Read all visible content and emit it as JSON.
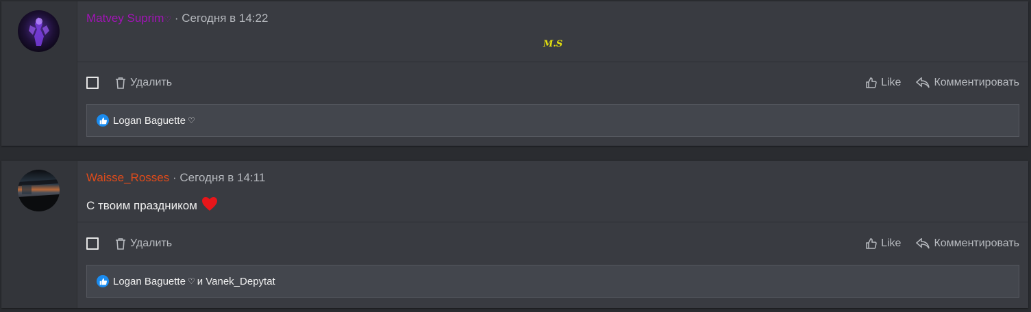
{
  "posts": [
    {
      "author": "Matvey Suprim",
      "author_deco": "♡",
      "separator": "·",
      "time": "Сегодня в 14:22",
      "text": "M.S",
      "actions": {
        "delete": "Удалить",
        "like": "Like",
        "comment": "Комментировать"
      },
      "likes": {
        "user1": "Logan Baguette",
        "heart": "♡",
        "conj": "",
        "user2": ""
      },
      "author_color": "#a313b8"
    },
    {
      "author": "Waisse_Rosses",
      "separator": "·",
      "time": "Сегодня в 14:11",
      "text": "С твоим праздником",
      "emoji": "heart",
      "actions": {
        "delete": "Удалить",
        "like": "Like",
        "comment": "Комментировать"
      },
      "likes": {
        "user1": "Logan Baguette",
        "heart": "♡",
        "conj": "и",
        "user2": "Vanek_Depytat"
      },
      "author_color": "#e14b1a"
    }
  ],
  "colors": {
    "background": "#2a2c30",
    "card": "#393b41",
    "like_badge": "#1a8cf0",
    "text_muted": "#b5b8bd"
  }
}
